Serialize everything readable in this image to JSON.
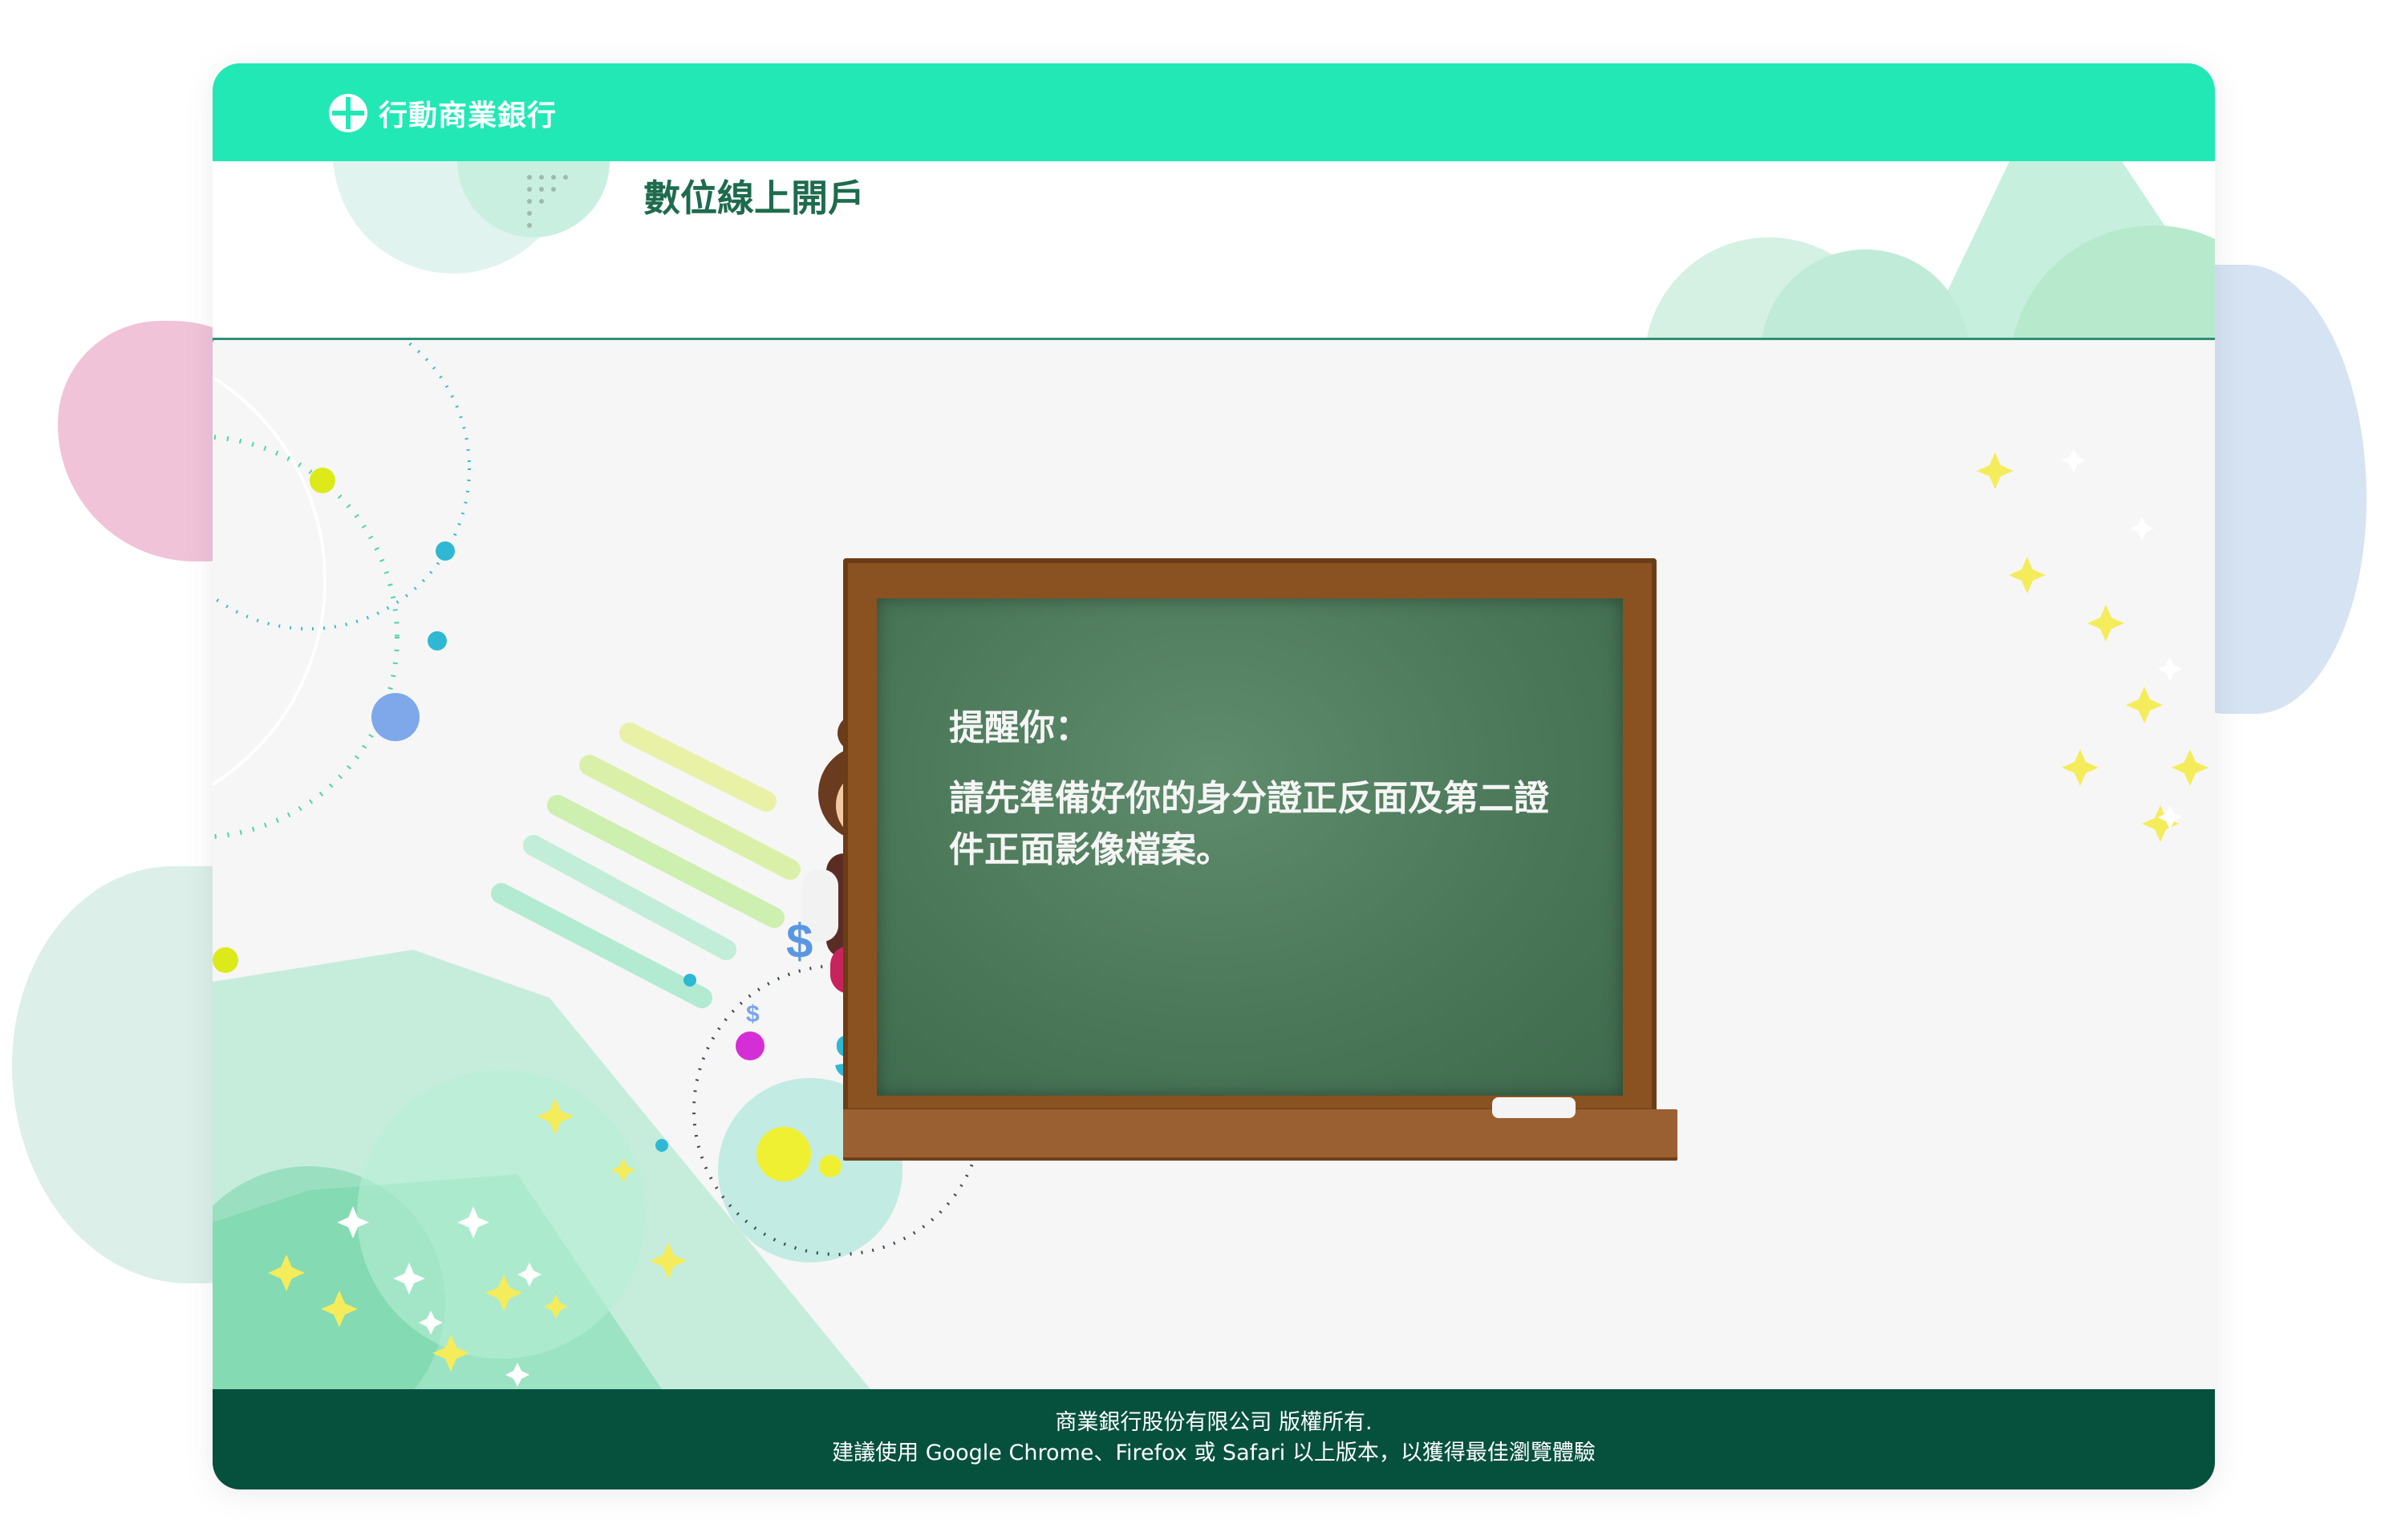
{
  "app": {
    "logo_text": "行動商業銀行"
  },
  "header": {
    "title": "數位線上開戶"
  },
  "notice": {
    "heading": "提醒你：",
    "body": "請先準備好你的身分證正反面及第二證件正面影像檔案。"
  },
  "footer": {
    "copyright": "商業銀行股份有限公司 版權所有.",
    "browser_note": "建議使用 Google Chrome、Firefox 或 Safari 以上版本，以獲得最佳瀏覽體驗"
  },
  "colors": {
    "topbar": "#22e8b6",
    "title": "#1e6b4d",
    "footer": "#06503e",
    "chalkboard": "#4b7859",
    "board_frame": "#8a5221"
  },
  "icons": {
    "logo": "bank-cross-logo-icon"
  }
}
